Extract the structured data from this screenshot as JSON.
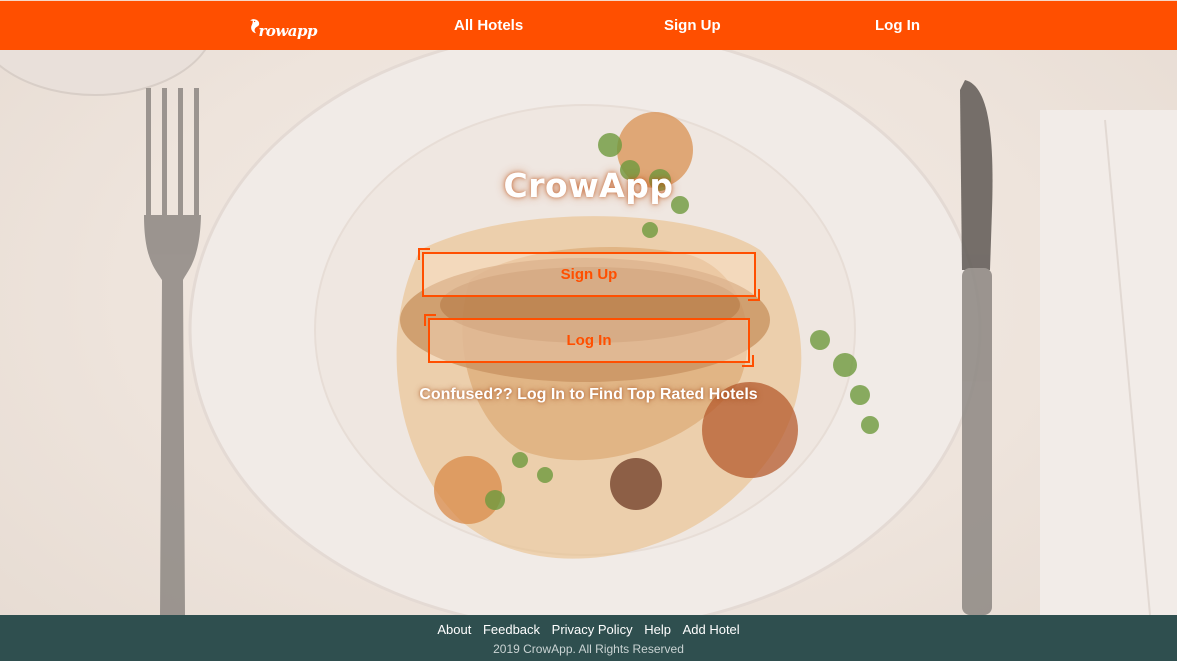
{
  "colors": {
    "brand_orange": "#ff4f00",
    "footer_bg": "#2f4f4f",
    "text_white": "#ffffff"
  },
  "nav": {
    "brand_logo_text": "rowapp",
    "logo_icon": "crow-icon",
    "links": {
      "all_hotels": "All Hotels",
      "sign_up": "Sign Up",
      "log_in": "Log In"
    }
  },
  "hero": {
    "title": "CrowApp",
    "signup_button": "Sign Up",
    "login_button": "Log In",
    "tagline": "Confused?? Log In to Find Top Rated Hotels"
  },
  "footer": {
    "links": {
      "about": "About",
      "feedback": "Feedback",
      "privacy": "Privacy Policy",
      "help": "Help",
      "add_hotel": "Add Hotel"
    },
    "copyright": "2019 CrowApp. All Rights Reserved"
  }
}
